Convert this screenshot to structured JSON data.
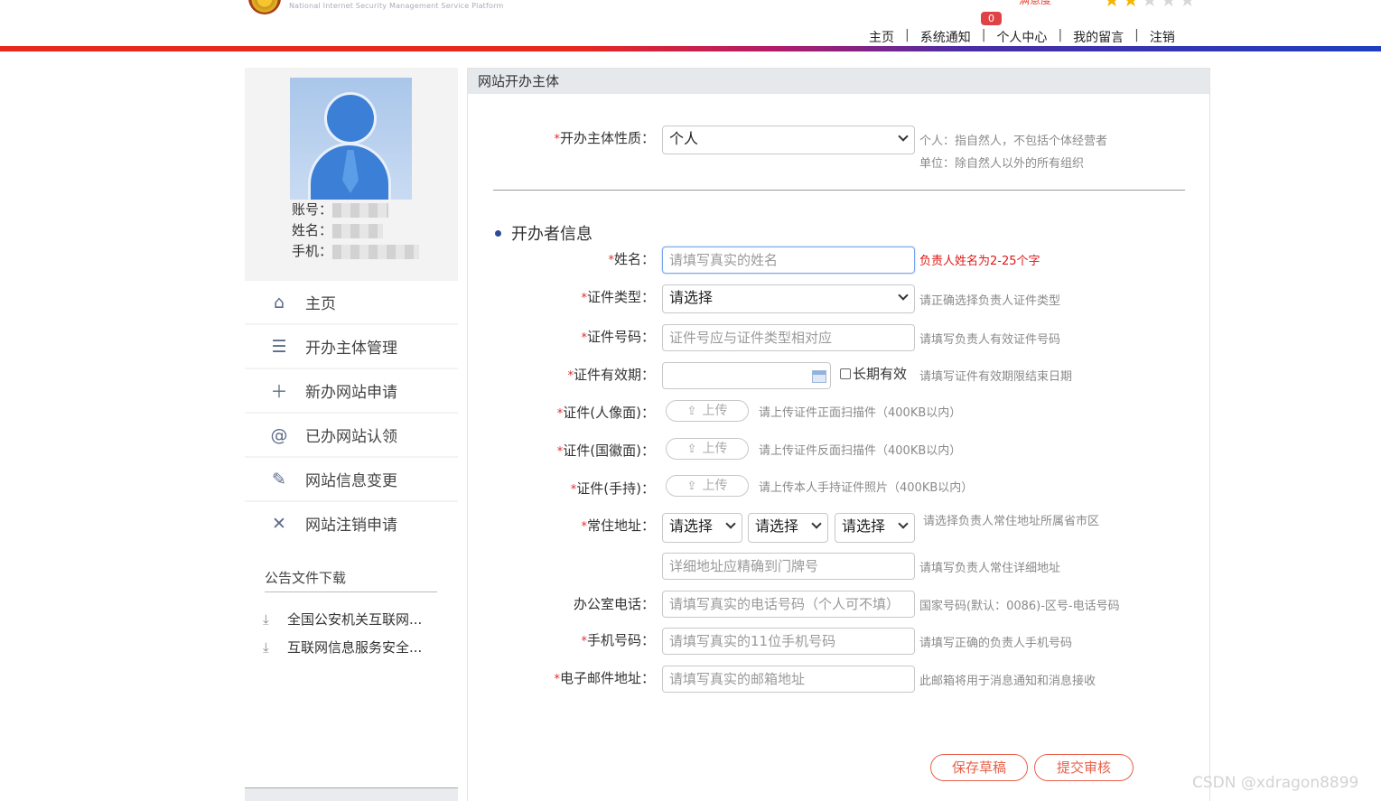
{
  "header": {
    "logo_subtitle": "National Internet Security Management Service Platform",
    "cropped_red_text": "满意度",
    "notification_count": "0",
    "nav": [
      "主页",
      "系统通知",
      "个人中心",
      "我的留言",
      "注销"
    ],
    "colors": {
      "bar_start": "#e8281f",
      "bar_end": "#1e3fbd"
    }
  },
  "sidebar": {
    "profile": {
      "account_label": "账号：",
      "name_label": "姓名：",
      "phone_label": "手机："
    },
    "menu": [
      {
        "label": "主页",
        "icon": "home-icon"
      },
      {
        "label": "开办主体管理",
        "icon": "list-icon"
      },
      {
        "label": "新办网站申请",
        "icon": "plus-icon"
      },
      {
        "label": "已办网站认领",
        "icon": "at-icon"
      },
      {
        "label": "网站信息变更",
        "icon": "edit-icon"
      },
      {
        "label": "网站注销申请",
        "icon": "close-icon"
      }
    ],
    "downloads": {
      "title": "公告文件下载",
      "items": [
        "全国公安机关互联网...",
        "互联网信息服务安全..."
      ]
    }
  },
  "main": {
    "title": "网站开办主体",
    "nature": {
      "label": "开办主体性质：",
      "value": "个人",
      "hint1": "个人：指自然人，不包括个体经营者",
      "hint2": "单位：除自然人以外的所有组织"
    },
    "section_title": "开办者信息",
    "fields": {
      "name": {
        "label": "姓名：",
        "placeholder": "请填写真实的姓名",
        "hint": "负责人姓名为2-25个字"
      },
      "id_type": {
        "label": "证件类型：",
        "value": "请选择",
        "hint": "请正确选择负责人证件类型"
      },
      "id_number": {
        "label": "证件号码：",
        "placeholder": "证件号应与证件类型相对应",
        "hint": "请填写负责人有效证件号码"
      },
      "id_expiry": {
        "label": "证件有效期：",
        "checkbox": "长期有效",
        "hint": "请填写证件有效期限结束日期"
      },
      "id_front": {
        "label": "证件(人像面)：",
        "button": "上传",
        "hint": "请上传证件正面扫描件（400KB以内）"
      },
      "id_back": {
        "label": "证件(国徽面)：",
        "button": "上传",
        "hint": "请上传证件反面扫描件（400KB以内）"
      },
      "id_hand": {
        "label": "证件(手持)：",
        "button": "上传",
        "hint": "请上传本人手持证件照片（400KB以内）"
      },
      "address": {
        "label": "常住地址：",
        "selects": [
          "请选择",
          "请选择",
          "请选择"
        ],
        "hint": "请选择负责人常住地址所属省市区",
        "detail_placeholder": "详细地址应精确到门牌号",
        "detail_hint": "请填写负责人常住详细地址"
      },
      "office_phone": {
        "label": "办公室电话：",
        "placeholder": "请填写真实的电话号码（个人可不填）",
        "hint": "国家号码(默认：0086)-区号-电话号码"
      },
      "mobile": {
        "label": "手机号码：",
        "placeholder": "请填写真实的11位手机号码",
        "hint": "请填写正确的负责人手机号码"
      },
      "email": {
        "label": "电子邮件地址：",
        "placeholder": "请填写真实的邮箱地址",
        "hint": "此邮箱将用于消息通知和消息接收"
      }
    },
    "buttons": {
      "save": "保存草稿",
      "submit": "提交审核"
    }
  },
  "watermark": "CSDN @xdragon8899"
}
